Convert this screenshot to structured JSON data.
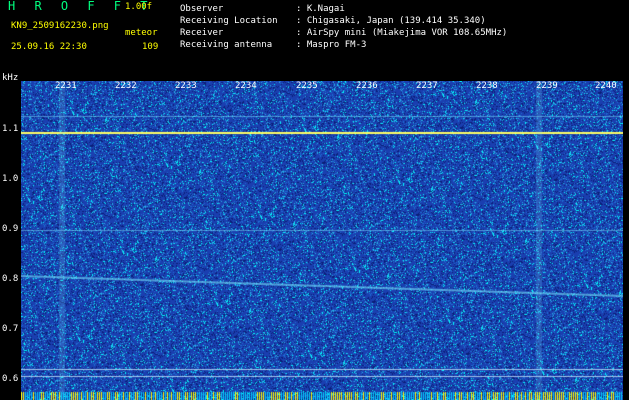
{
  "header": {
    "title": "H R O F F T",
    "version": "1.00f",
    "filename": "KN9_2509162230.png",
    "mode": "meteor",
    "datetime": "25.09.16 22:30",
    "count": "109"
  },
  "station": [
    {
      "label": "Observer",
      "value": ": K.Nagai"
    },
    {
      "label": "Receiving Location",
      "value": ": Chigasaki, Japan (139.414 35.340)"
    },
    {
      "label": "Receiver",
      "value": ": AirSpy mini (Miakejima VOR 108.65MHz)"
    },
    {
      "label": "Receiving antenna",
      "value": ": Maspro FM-3"
    }
  ],
  "spectrogram": {
    "y_unit": "kHz",
    "y_ticks": [
      "1.1",
      "1.0",
      "0.9",
      "0.8",
      "0.7",
      "0.6"
    ],
    "x_ticks": [
      "2231",
      "2232",
      "2233",
      "2234",
      "2235",
      "2236",
      "2237",
      "2238",
      "2239",
      "2240"
    ],
    "colors": {
      "background": "#1a3fb0",
      "noise": "#00ffff",
      "carrier": "#ffff66",
      "footer": "#ffff00"
    }
  }
}
